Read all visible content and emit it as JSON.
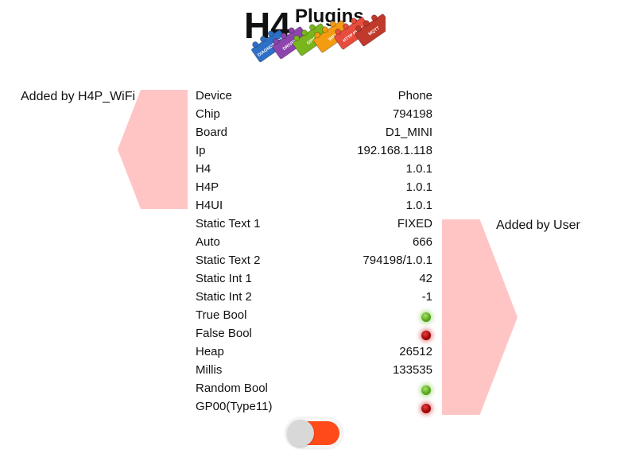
{
  "logo": {
    "prefix": "H4",
    "name": "Plugins",
    "bricks": [
      "DIAGNOSTICS",
      "DRIVERS",
      "GPIO",
      "WiFi",
      "HTTP REST",
      "MQTT"
    ],
    "brick_colors": [
      "#2e6fc8",
      "#8e44ad",
      "#79b51c",
      "#f39c12",
      "#e74c3c",
      "#c0392b"
    ]
  },
  "annotations": {
    "wifi": "Added by H4P_WiFi",
    "user": "Added by User"
  },
  "rows": [
    {
      "label": "Device",
      "value": "Phone"
    },
    {
      "label": "Chip",
      "value": "794198"
    },
    {
      "label": "Board",
      "value": "D1_MINI"
    },
    {
      "label": "Ip",
      "value": "192.168.1.118"
    },
    {
      "label": "H4",
      "value": "1.0.1"
    },
    {
      "label": "H4P",
      "value": "1.0.1"
    },
    {
      "label": "H4UI",
      "value": "1.0.1"
    },
    {
      "label": "Static Text 1",
      "value": "FIXED"
    },
    {
      "label": "Auto",
      "value": "666"
    },
    {
      "label": "Static Text 2",
      "value": "794198/1.0.1"
    },
    {
      "label": "Static Int 1",
      "value": "42"
    },
    {
      "label": "Static Int 2",
      "value": "-1"
    },
    {
      "label": "True Bool",
      "led": "green"
    },
    {
      "label": "False Bool",
      "led": "red"
    },
    {
      "label": "Heap",
      "value": "26512"
    },
    {
      "label": "Millis",
      "value": "133535"
    },
    {
      "label": "Random Bool",
      "led": "green"
    },
    {
      "label": "GP00(Type11)",
      "led": "red"
    }
  ],
  "toggle": {
    "state": "on",
    "track_color": "#ff4a1a"
  },
  "colors": {
    "arrow": "#ffc5c5",
    "led_green": "#5aa81c",
    "led_red": "#a00000"
  }
}
